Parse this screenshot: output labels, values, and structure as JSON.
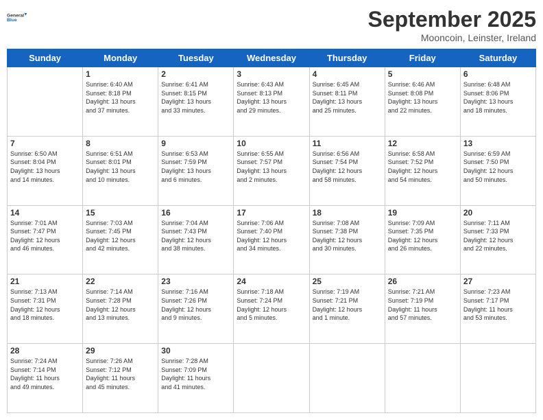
{
  "header": {
    "logo_line1": "General",
    "logo_line2": "Blue",
    "month": "September 2025",
    "location": "Mooncoin, Leinster, Ireland"
  },
  "weekdays": [
    "Sunday",
    "Monday",
    "Tuesday",
    "Wednesday",
    "Thursday",
    "Friday",
    "Saturday"
  ],
  "weeks": [
    [
      {
        "day": "",
        "info": ""
      },
      {
        "day": "1",
        "info": "Sunrise: 6:40 AM\nSunset: 8:18 PM\nDaylight: 13 hours\nand 37 minutes."
      },
      {
        "day": "2",
        "info": "Sunrise: 6:41 AM\nSunset: 8:15 PM\nDaylight: 13 hours\nand 33 minutes."
      },
      {
        "day": "3",
        "info": "Sunrise: 6:43 AM\nSunset: 8:13 PM\nDaylight: 13 hours\nand 29 minutes."
      },
      {
        "day": "4",
        "info": "Sunrise: 6:45 AM\nSunset: 8:11 PM\nDaylight: 13 hours\nand 25 minutes."
      },
      {
        "day": "5",
        "info": "Sunrise: 6:46 AM\nSunset: 8:08 PM\nDaylight: 13 hours\nand 22 minutes."
      },
      {
        "day": "6",
        "info": "Sunrise: 6:48 AM\nSunset: 8:06 PM\nDaylight: 13 hours\nand 18 minutes."
      }
    ],
    [
      {
        "day": "7",
        "info": "Sunrise: 6:50 AM\nSunset: 8:04 PM\nDaylight: 13 hours\nand 14 minutes."
      },
      {
        "day": "8",
        "info": "Sunrise: 6:51 AM\nSunset: 8:01 PM\nDaylight: 13 hours\nand 10 minutes."
      },
      {
        "day": "9",
        "info": "Sunrise: 6:53 AM\nSunset: 7:59 PM\nDaylight: 13 hours\nand 6 minutes."
      },
      {
        "day": "10",
        "info": "Sunrise: 6:55 AM\nSunset: 7:57 PM\nDaylight: 13 hours\nand 2 minutes."
      },
      {
        "day": "11",
        "info": "Sunrise: 6:56 AM\nSunset: 7:54 PM\nDaylight: 12 hours\nand 58 minutes."
      },
      {
        "day": "12",
        "info": "Sunrise: 6:58 AM\nSunset: 7:52 PM\nDaylight: 12 hours\nand 54 minutes."
      },
      {
        "day": "13",
        "info": "Sunrise: 6:59 AM\nSunset: 7:50 PM\nDaylight: 12 hours\nand 50 minutes."
      }
    ],
    [
      {
        "day": "14",
        "info": "Sunrise: 7:01 AM\nSunset: 7:47 PM\nDaylight: 12 hours\nand 46 minutes."
      },
      {
        "day": "15",
        "info": "Sunrise: 7:03 AM\nSunset: 7:45 PM\nDaylight: 12 hours\nand 42 minutes."
      },
      {
        "day": "16",
        "info": "Sunrise: 7:04 AM\nSunset: 7:43 PM\nDaylight: 12 hours\nand 38 minutes."
      },
      {
        "day": "17",
        "info": "Sunrise: 7:06 AM\nSunset: 7:40 PM\nDaylight: 12 hours\nand 34 minutes."
      },
      {
        "day": "18",
        "info": "Sunrise: 7:08 AM\nSunset: 7:38 PM\nDaylight: 12 hours\nand 30 minutes."
      },
      {
        "day": "19",
        "info": "Sunrise: 7:09 AM\nSunset: 7:35 PM\nDaylight: 12 hours\nand 26 minutes."
      },
      {
        "day": "20",
        "info": "Sunrise: 7:11 AM\nSunset: 7:33 PM\nDaylight: 12 hours\nand 22 minutes."
      }
    ],
    [
      {
        "day": "21",
        "info": "Sunrise: 7:13 AM\nSunset: 7:31 PM\nDaylight: 12 hours\nand 18 minutes."
      },
      {
        "day": "22",
        "info": "Sunrise: 7:14 AM\nSunset: 7:28 PM\nDaylight: 12 hours\nand 13 minutes."
      },
      {
        "day": "23",
        "info": "Sunrise: 7:16 AM\nSunset: 7:26 PM\nDaylight: 12 hours\nand 9 minutes."
      },
      {
        "day": "24",
        "info": "Sunrise: 7:18 AM\nSunset: 7:24 PM\nDaylight: 12 hours\nand 5 minutes."
      },
      {
        "day": "25",
        "info": "Sunrise: 7:19 AM\nSunset: 7:21 PM\nDaylight: 12 hours\nand 1 minute."
      },
      {
        "day": "26",
        "info": "Sunrise: 7:21 AM\nSunset: 7:19 PM\nDaylight: 11 hours\nand 57 minutes."
      },
      {
        "day": "27",
        "info": "Sunrise: 7:23 AM\nSunset: 7:17 PM\nDaylight: 11 hours\nand 53 minutes."
      }
    ],
    [
      {
        "day": "28",
        "info": "Sunrise: 7:24 AM\nSunset: 7:14 PM\nDaylight: 11 hours\nand 49 minutes."
      },
      {
        "day": "29",
        "info": "Sunrise: 7:26 AM\nSunset: 7:12 PM\nDaylight: 11 hours\nand 45 minutes."
      },
      {
        "day": "30",
        "info": "Sunrise: 7:28 AM\nSunset: 7:09 PM\nDaylight: 11 hours\nand 41 minutes."
      },
      {
        "day": "",
        "info": ""
      },
      {
        "day": "",
        "info": ""
      },
      {
        "day": "",
        "info": ""
      },
      {
        "day": "",
        "info": ""
      }
    ]
  ]
}
